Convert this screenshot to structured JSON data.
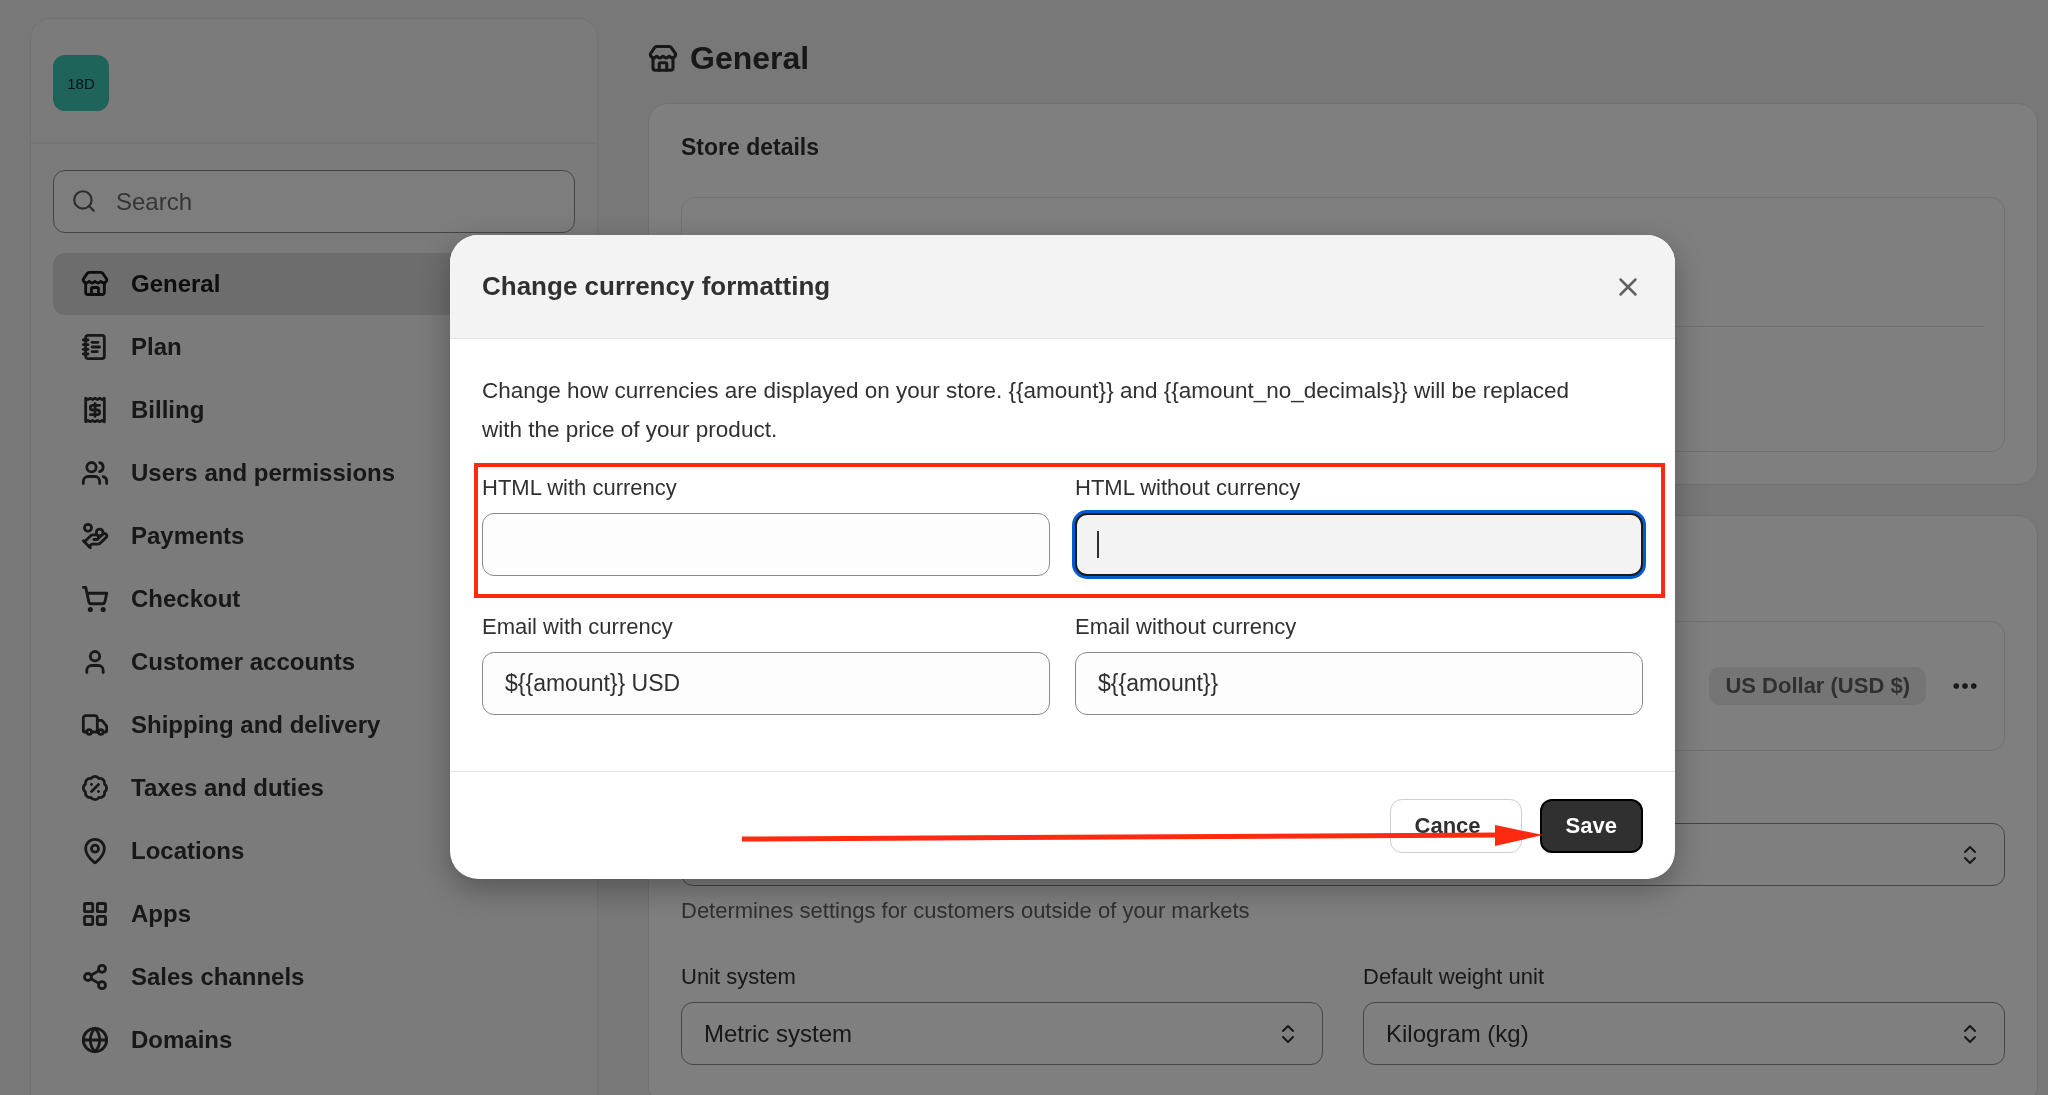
{
  "sidebar": {
    "store_badge": "18D",
    "search": {
      "placeholder": "Search"
    },
    "items": [
      {
        "label": "General",
        "selected": true
      },
      {
        "label": "Plan",
        "selected": false
      },
      {
        "label": "Billing",
        "selected": false
      },
      {
        "label": "Users and permissions",
        "selected": false
      },
      {
        "label": "Payments",
        "selected": false
      },
      {
        "label": "Checkout",
        "selected": false
      },
      {
        "label": "Customer accounts",
        "selected": false
      },
      {
        "label": "Shipping and delivery",
        "selected": false
      },
      {
        "label": "Taxes and duties",
        "selected": false
      },
      {
        "label": "Locations",
        "selected": false
      },
      {
        "label": "Apps",
        "selected": false
      },
      {
        "label": "Sales channels",
        "selected": false
      },
      {
        "label": "Domains",
        "selected": false
      }
    ]
  },
  "page": {
    "title": "General",
    "store_details": {
      "title": "Store details"
    },
    "currency": {
      "badge": "US Dollar (USD $)"
    },
    "region_help": "Determines settings for customers outside of your markets",
    "selects": [
      {
        "label": "Unit system",
        "value": "Metric system"
      },
      {
        "label": "Default weight unit",
        "value": "Kilogram (kg)"
      }
    ]
  },
  "modal": {
    "title": "Change currency formatting",
    "description": "Change how currencies are displayed on your store. {{amount}} and {{amount_no_decimals}} will be replaced with the price of your product.",
    "rows": [
      {
        "highlighted": true,
        "fields": [
          {
            "label": "HTML with currency",
            "focused": false
          },
          {
            "label": "HTML without currency",
            "focused": true
          }
        ]
      },
      {
        "highlighted": false,
        "fields": [
          {
            "label": "Email with currency",
            "value": "${{amount}} USD",
            "focused": false
          },
          {
            "label": "Email without currency",
            "value": "${{amount}}",
            "focused": false
          }
        ]
      }
    ],
    "buttons": [
      {
        "label": "Cance",
        "kind": "secondary"
      },
      {
        "label": "Save",
        "kind": "primary"
      }
    ],
    "arrow_to_save": true
  }
}
